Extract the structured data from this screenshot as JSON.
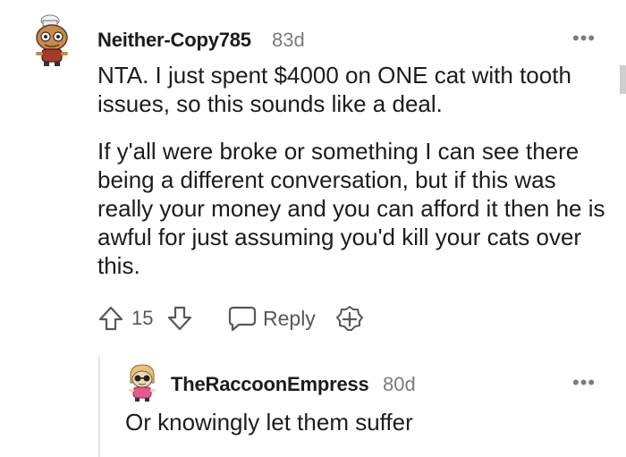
{
  "comment": {
    "username": "Neither-Copy785",
    "age": "83d",
    "more_label": "•••",
    "paragraphs": [
      "NTA. I just spent $4000 on ONE cat with tooth issues, so this sounds like a deal.",
      "If y'all were broke or something I can see there being a different conversation, but if this was really your money and you can afford it then he is awful for just assuming you'd kill your cats over this."
    ],
    "vote_count": "15",
    "reply_label": "Reply",
    "icons": {
      "avatar": "snoo-avatar-icon",
      "upvote": "arrow-up-icon",
      "downvote": "arrow-down-icon",
      "reply": "speech-bubble-icon",
      "award": "award-plus-icon",
      "more": "ellipsis-icon"
    }
  },
  "reply": {
    "username": "TheRaccoonEmpress",
    "age": "80d",
    "more_label": "•••",
    "body": "Or knowingly let them suffer",
    "icons": {
      "avatar": "snoo-avatar-icon",
      "more": "ellipsis-icon"
    }
  },
  "colors": {
    "text_primary": "#1c1c1c",
    "text_secondary": "#7c7c7c",
    "action_gray": "#585858",
    "thread_line": "#e6e6e6"
  }
}
